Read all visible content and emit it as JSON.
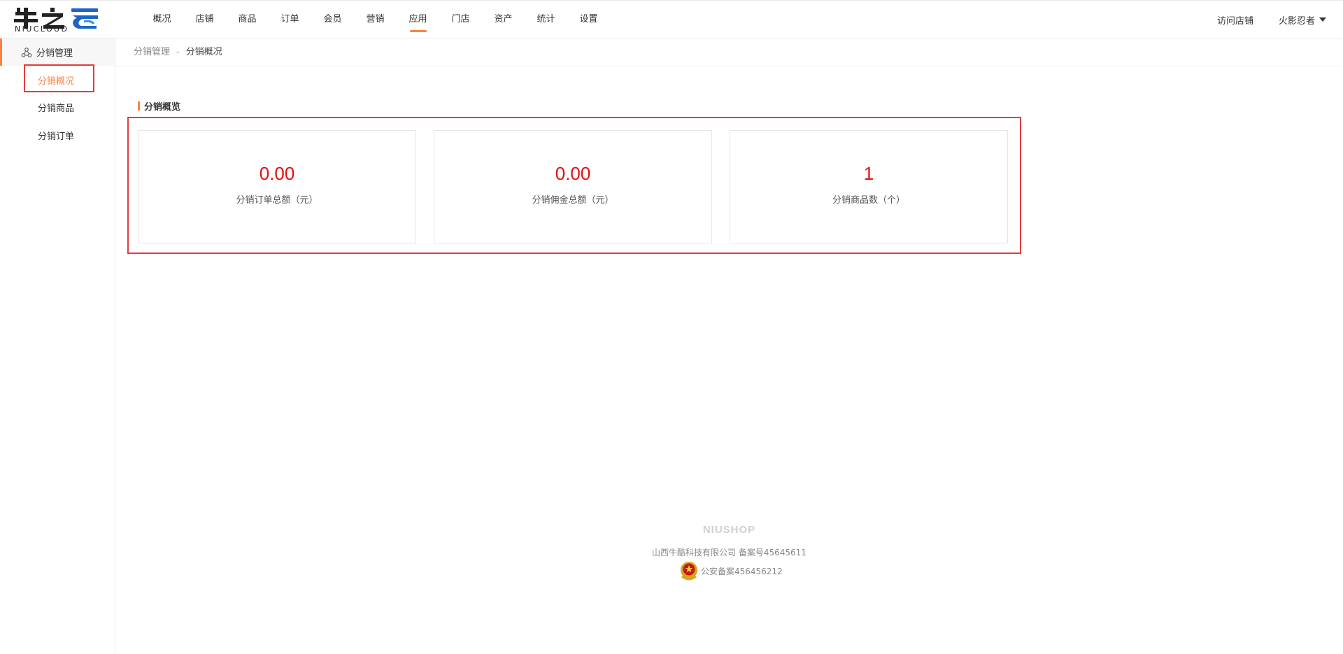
{
  "header": {
    "logo_text": "NIUCLOUD",
    "nav": [
      "概况",
      "店铺",
      "商品",
      "订单",
      "会员",
      "营销",
      "应用",
      "门店",
      "资产",
      "统计",
      "设置"
    ],
    "active_nav": "应用",
    "visit_store": "访问店铺",
    "username": "火影忍者"
  },
  "sidebar": {
    "group_label": "分销管理",
    "items": [
      {
        "label": "分销概况",
        "active": true
      },
      {
        "label": "分销商品",
        "active": false
      },
      {
        "label": "分销订单",
        "active": false
      }
    ]
  },
  "breadcrumb": {
    "parent": "分销管理",
    "separator": "-",
    "current": "分销概况"
  },
  "main": {
    "section_title": "分销概览",
    "cards": [
      {
        "value": "0.00",
        "label": "分销订单总额（元）"
      },
      {
        "value": "0.00",
        "label": "分销佣金总额（元）"
      },
      {
        "value": "1",
        "label": "分销商品数（个）"
      }
    ]
  },
  "footer": {
    "brand": "NIUSHOP",
    "company": "山西牛酷科技有限公司  备案号45645611",
    "police": "公安备案456456212"
  },
  "colors": {
    "accent": "#ff8143",
    "value": "#e50e0e",
    "highlight_box": "#e43b3b"
  },
  "icons": {
    "sidebar_group": "distribution-icon",
    "user_menu": "caret-down-icon",
    "footer_police": "police-emblem-icon"
  }
}
